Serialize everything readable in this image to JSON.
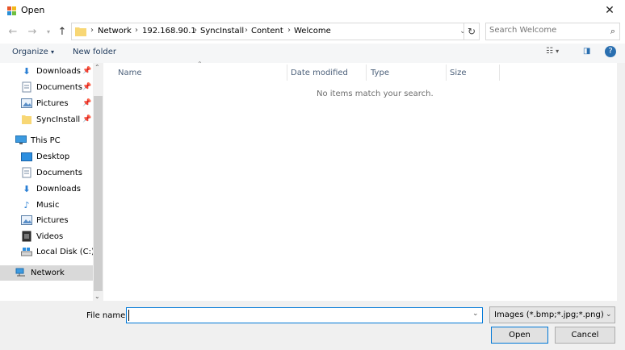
{
  "window": {
    "title": "Open",
    "close_glyph": "✕"
  },
  "address": {
    "crumbs": [
      "Network",
      "192.168.90.1",
      "SyncInstall",
      "Content",
      "Welcome"
    ],
    "sep_glyph": "›"
  },
  "search": {
    "placeholder": "Search Welcome"
  },
  "toolbar": {
    "organize_label": "Organize",
    "new_folder_label": "New folder"
  },
  "nav": {
    "quick": [
      {
        "label": "Downloads",
        "icon": "down-arrow-icon"
      },
      {
        "label": "Documents",
        "icon": "documents-icon"
      },
      {
        "label": "Pictures",
        "icon": "pictures-icon"
      },
      {
        "label": "SyncInstall",
        "icon": "folder-icon"
      }
    ],
    "this_pc_label": "This PC",
    "pc_items": [
      {
        "label": "Desktop",
        "icon": "desktop-icon"
      },
      {
        "label": "Documents",
        "icon": "documents-icon"
      },
      {
        "label": "Downloads",
        "icon": "down-arrow-icon"
      },
      {
        "label": "Music",
        "icon": "music-icon"
      },
      {
        "label": "Pictures",
        "icon": "pictures-icon"
      },
      {
        "label": "Videos",
        "icon": "videos-icon"
      },
      {
        "label": "Local Disk (C:)",
        "icon": "drive-icon"
      }
    ],
    "network_label": "Network"
  },
  "columns": [
    "Name",
    "Date modified",
    "Type",
    "Size"
  ],
  "empty_message": "No items match your search.",
  "footer": {
    "file_name_label": "File name:",
    "file_name_value": "",
    "filter_label": "Images  (*.bmp;*.jpg;*.png)",
    "open_label": "Open",
    "cancel_label": "Cancel"
  },
  "colors": {
    "accent": "#0078d7",
    "folder": "#f8d775",
    "nav_selected": "#d9d9d9"
  }
}
